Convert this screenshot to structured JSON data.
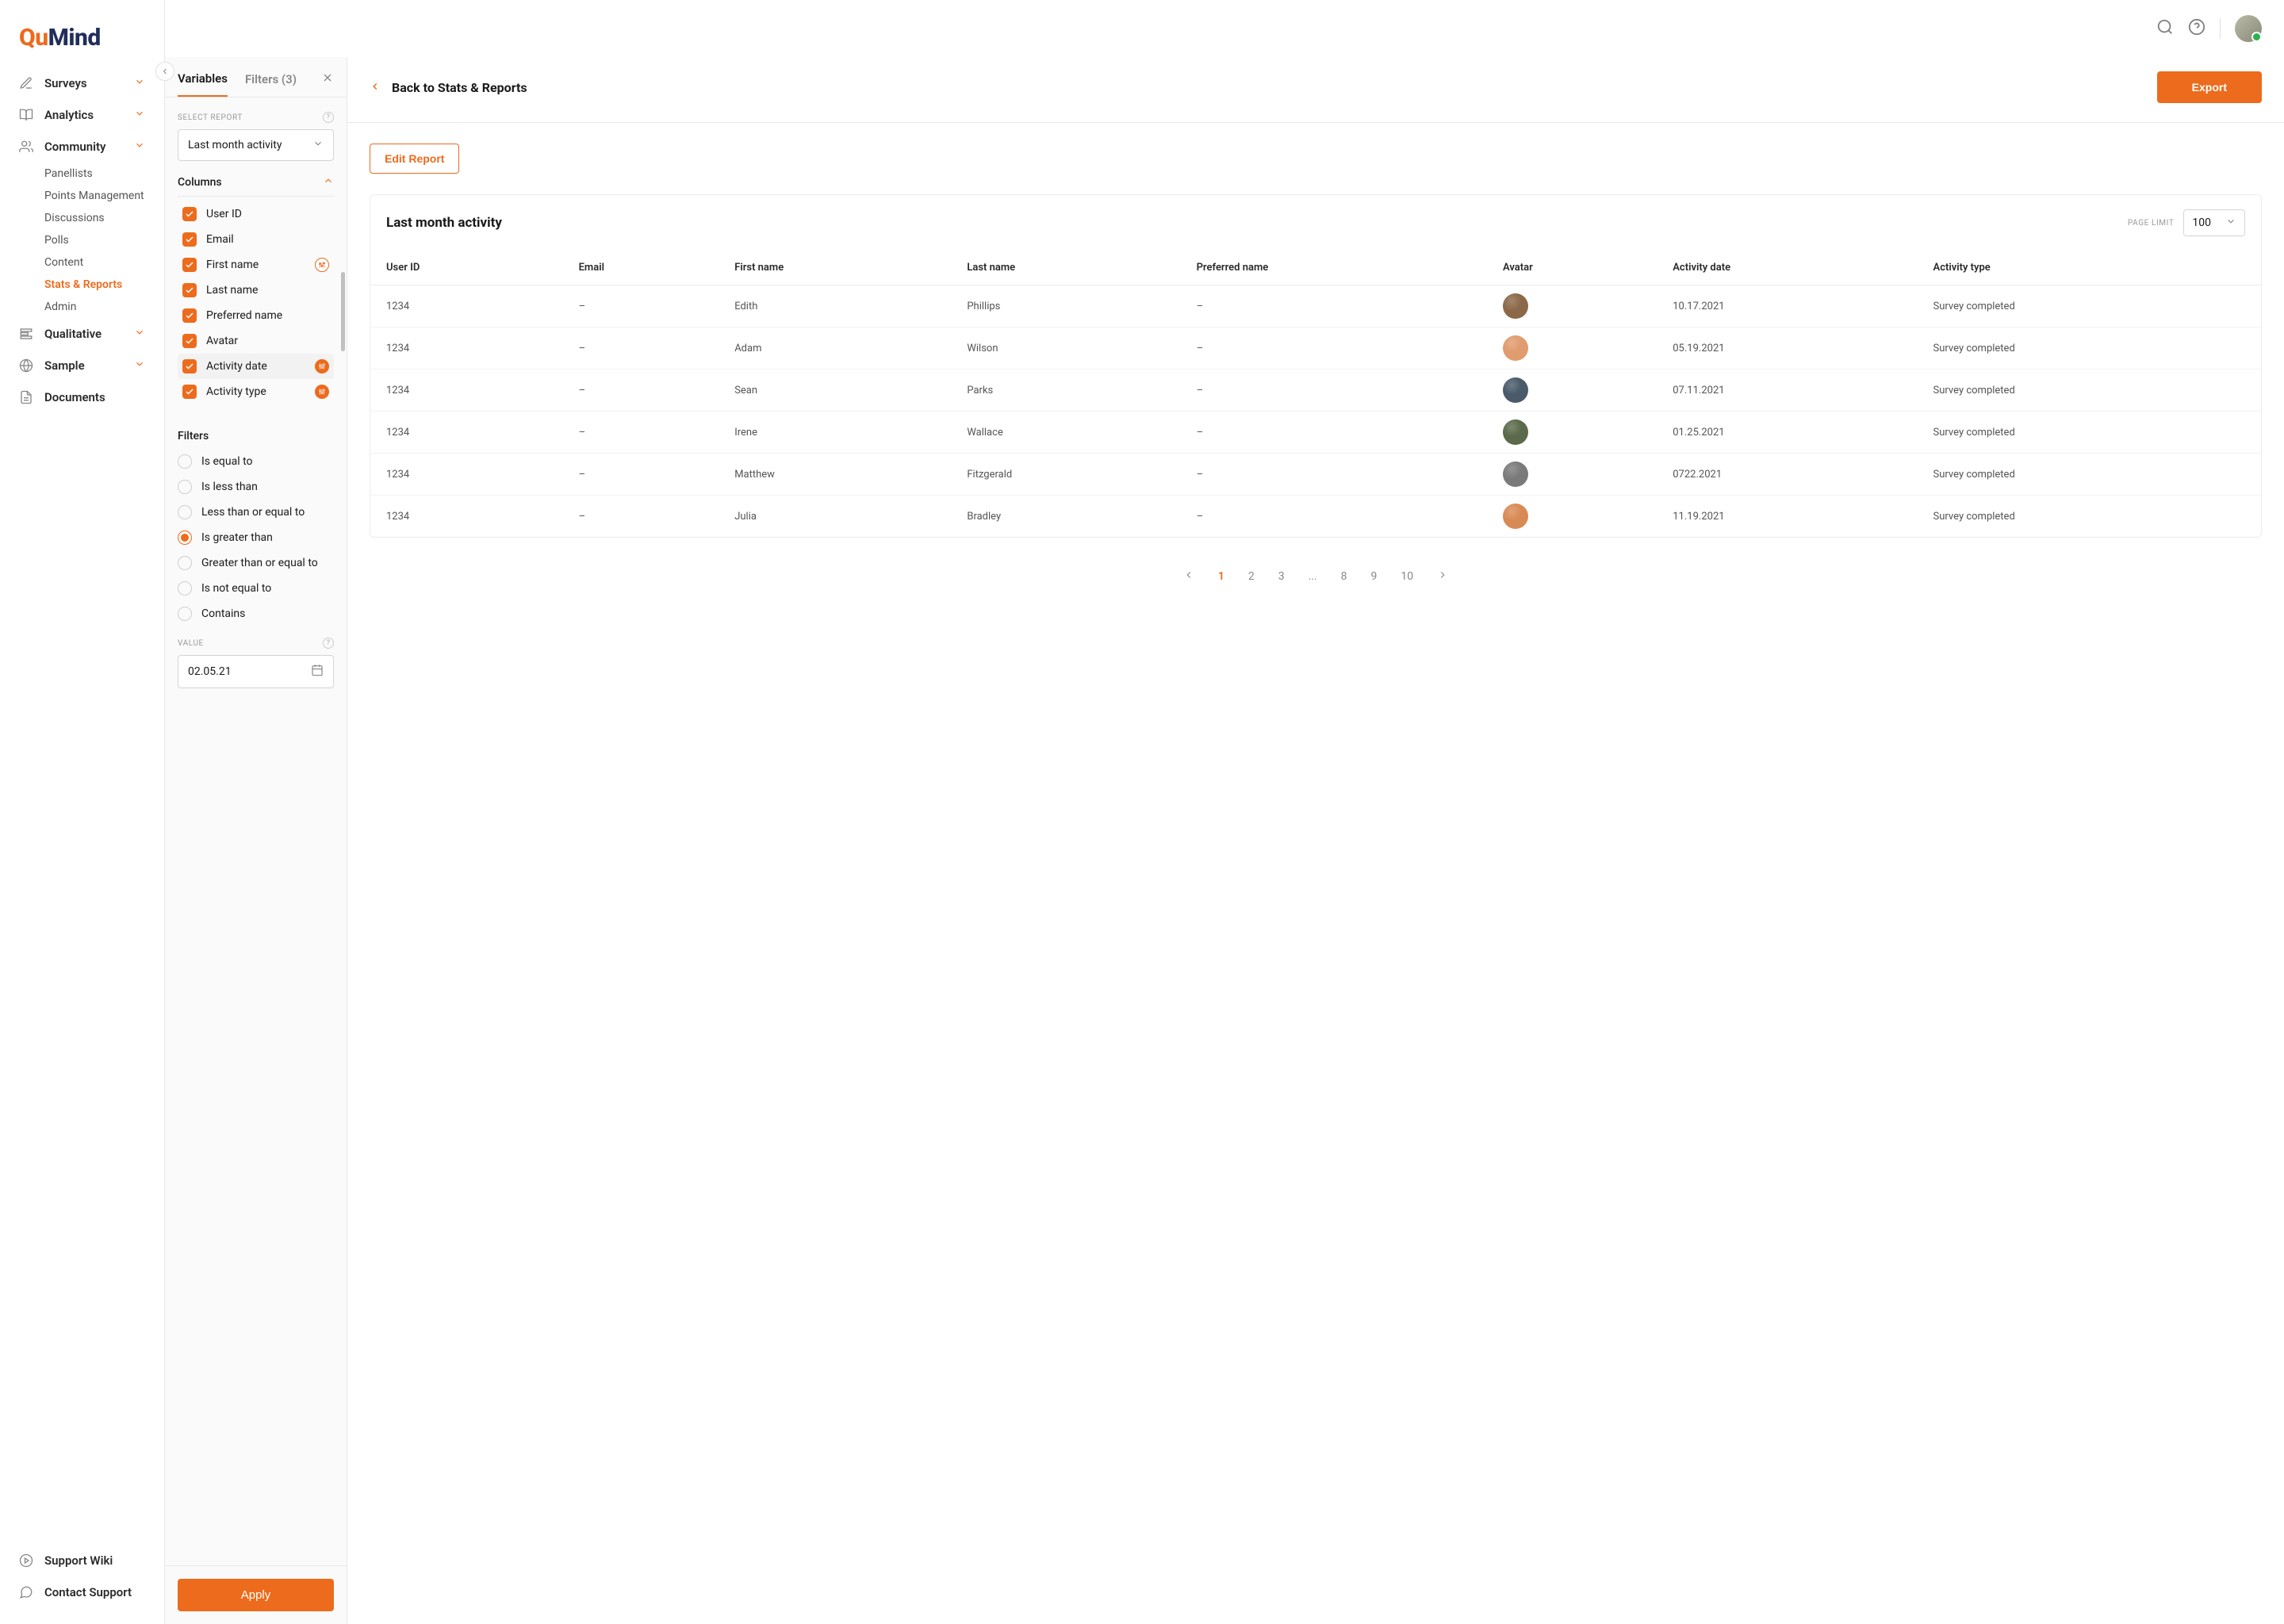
{
  "brand": {
    "first": "Qu",
    "rest": "Mind"
  },
  "nav": {
    "surveys": "Surveys",
    "analytics": "Analytics",
    "community": "Community",
    "community_sub": {
      "panellists": "Panellists",
      "points": "Points Management",
      "discussions": "Discussions",
      "polls": "Polls",
      "content": "Content",
      "stats": "Stats & Reports",
      "admin": "Admin"
    },
    "qualitative": "Qualitative",
    "sample": "Sample",
    "documents": "Documents",
    "support_wiki": "Support Wiki",
    "contact_support": "Contact Support"
  },
  "panel": {
    "tab_variables": "Variables",
    "tab_filters": "Filters (3)",
    "select_report_label": "SELECT REPORT",
    "selected_report": "Last month activity",
    "columns_label": "Columns",
    "columns": [
      {
        "label": "User ID",
        "badge": null
      },
      {
        "label": "Email",
        "badge": null
      },
      {
        "label": "First name",
        "badge": "outline"
      },
      {
        "label": "Last name",
        "badge": null
      },
      {
        "label": "Preferred name",
        "badge": null
      },
      {
        "label": "Avatar",
        "badge": null
      },
      {
        "label": "Activity date",
        "badge": "solid",
        "hl": true
      },
      {
        "label": "Activity type",
        "badge": "solid"
      }
    ],
    "filters_label": "Filters",
    "filter_ops": {
      "eq": "Is equal to",
      "lt": "Is less than",
      "lte": "Less than or equal to",
      "gt": "Is greater than",
      "gte": "Greater than or equal to",
      "neq": "Is not equal to",
      "contains": "Contains"
    },
    "selected_op": "gt",
    "value_label": "VALUE",
    "value": "02.05.21",
    "apply": "Apply"
  },
  "header": {
    "back": "Back to Stats & Reports",
    "export": "Export",
    "edit_report": "Edit Report"
  },
  "table": {
    "title": "Last month activity",
    "page_limit_label": "PAGE LIMIT",
    "page_limit": "100",
    "cols": {
      "user_id": "User ID",
      "email": "Email",
      "first": "First name",
      "last": "Last name",
      "pref": "Preferred name",
      "avatar": "Avatar",
      "date": "Activity date",
      "type": "Activity type"
    },
    "rows": [
      {
        "id": "1234",
        "email": "–",
        "first": "Edith",
        "last": "Phillips",
        "pref": "–",
        "avatar": "#8b6848",
        "date": "10.17.2021",
        "type": "Survey completed"
      },
      {
        "id": "1234",
        "email": "–",
        "first": "Adam",
        "last": "Wilson",
        "pref": "–",
        "avatar": "#e09b6e",
        "date": "05.19.2021",
        "type": "Survey completed"
      },
      {
        "id": "1234",
        "email": "–",
        "first": "Sean",
        "last": "Parks",
        "pref": "–",
        "avatar": "#4a5a6a",
        "date": "07.11.2021",
        "type": "Survey completed"
      },
      {
        "id": "1234",
        "email": "–",
        "first": "Irene",
        "last": "Wallace",
        "pref": "–",
        "avatar": "#5b6a4a",
        "date": "01.25.2021",
        "type": "Survey completed"
      },
      {
        "id": "1234",
        "email": "–",
        "first": "Matthew",
        "last": "Fitzgerald",
        "pref": "–",
        "avatar": "#7a7a7a",
        "date": "0722.2021",
        "type": "Survey completed"
      },
      {
        "id": "1234",
        "email": "–",
        "first": "Julia",
        "last": "Bradley",
        "pref": "–",
        "avatar": "#d88a55",
        "date": "11.19.2021",
        "type": "Survey completed"
      }
    ]
  },
  "pagination": {
    "pages": [
      "1",
      "2",
      "3",
      "...",
      "8",
      "9",
      "10"
    ],
    "active": "1"
  }
}
